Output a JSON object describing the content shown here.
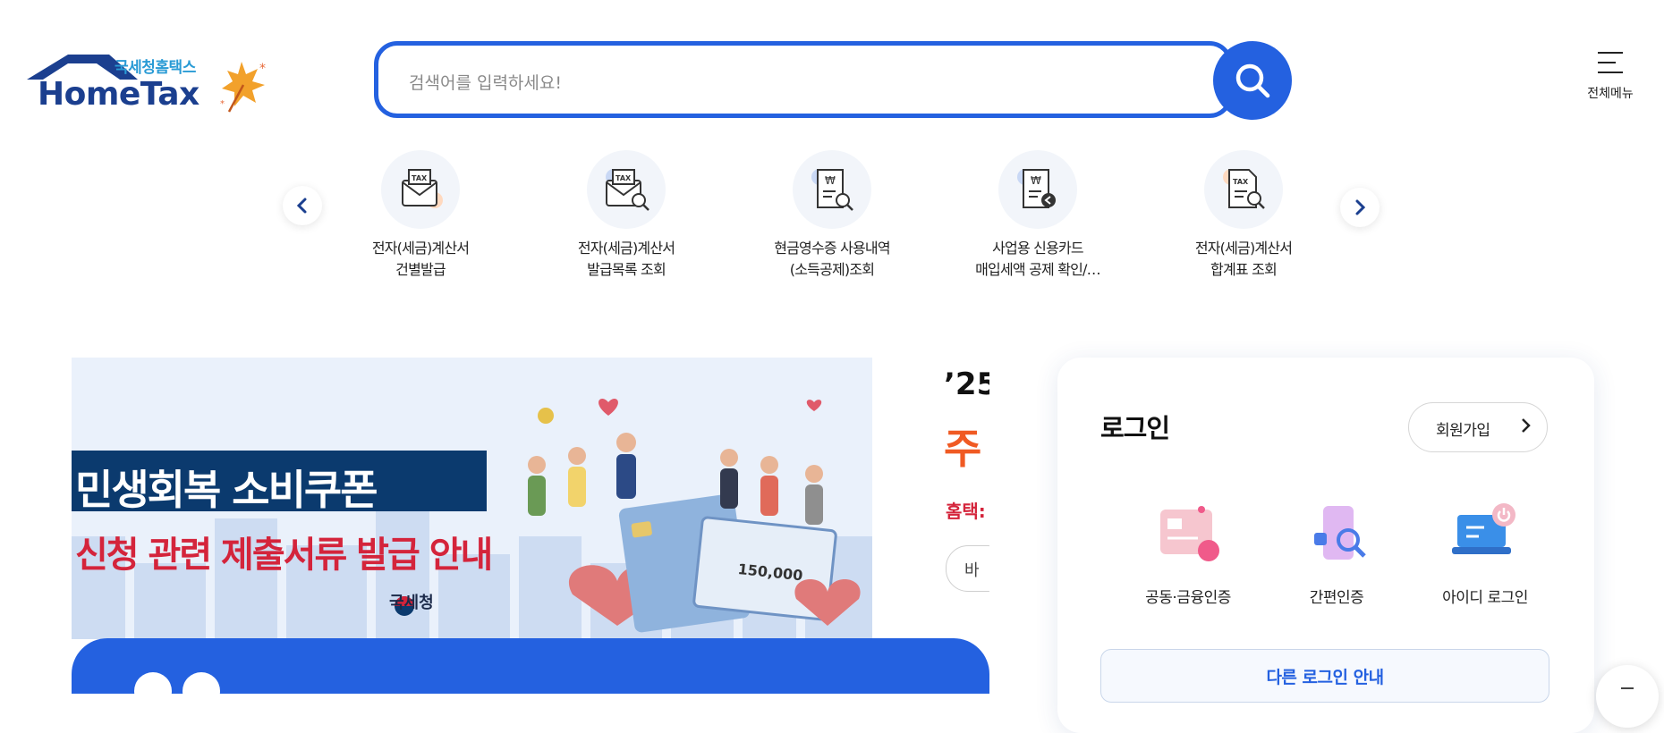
{
  "header": {
    "logo_small": "국세청홈택스",
    "logo_big": "HomeTax",
    "search_placeholder": "검색어를 입력하세요!",
    "menu_label": "전체메뉴"
  },
  "quick_menu": [
    {
      "label": "전자(세금)계산서\n건별발급",
      "icon": "tax-envelope-icon"
    },
    {
      "label": "전자(세금)계산서\n발급목록 조회",
      "icon": "tax-envelope-search-icon"
    },
    {
      "label": "현금영수증 사용내역\n(소득공제)조회",
      "icon": "receipt-search-icon"
    },
    {
      "label": "사업용 신용카드\n매입세액 공제 확인/…",
      "icon": "receipt-return-icon"
    },
    {
      "label": "전자(세금)계산서\n합계표 조회",
      "icon": "tax-document-search-icon"
    }
  ],
  "banner": {
    "title": "민생회복 소비쿠폰",
    "subtitle": "신청 관련 제출서류 발급 안내",
    "agency": "국세청",
    "card_amount": "150,000",
    "side_year": "’25",
    "side_heading": "주",
    "side_sub": "홈택:",
    "side_button": "바"
  },
  "login": {
    "title": "로그인",
    "join_button": "회원가입",
    "options": [
      {
        "label": "공동·금융인증",
        "icon": "certificate-icon"
      },
      {
        "label": "간편인증",
        "icon": "simple-auth-icon"
      },
      {
        "label": "아이디 로그인",
        "icon": "id-login-icon"
      }
    ],
    "other_login": "다른 로그인 안내"
  },
  "colors": {
    "primary": "#2461e0",
    "logo_navy": "#1b3f8f",
    "banner_red": "#d4243b",
    "banner_navy": "#0b3a6e"
  }
}
